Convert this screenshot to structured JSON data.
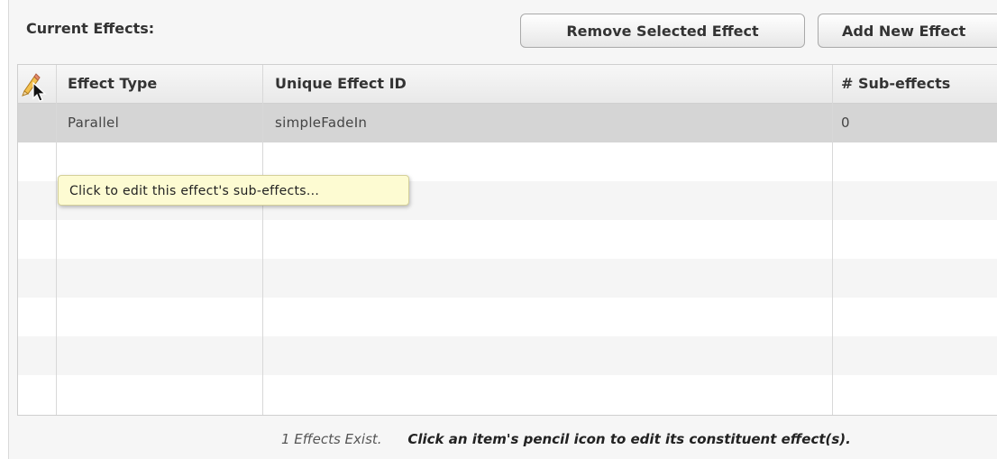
{
  "panel": {
    "title": "Current Effects:",
    "remove_button_label": "Remove Selected Effect",
    "add_button_label": "Add New Effect"
  },
  "table": {
    "columns": [
      "",
      "Effect Type",
      "Unique Effect ID",
      "# Sub-effects"
    ],
    "rows": [
      {
        "effect_type": "Parallel",
        "effect_id": "simpleFadeIn",
        "sub_effects": "0",
        "selected": true
      }
    ]
  },
  "tooltip": {
    "text": "Click to edit this effect's sub-effects..."
  },
  "footer": {
    "count_text": "1 Effects Exist.",
    "hint_text": "Click an item's pencil icon to edit its constituent effect(s)."
  },
  "icons": {
    "edit": "pencil-icon",
    "pointer": "mouse-cursor-icon"
  },
  "colors": {
    "selected_row": "#d5d5d5",
    "tooltip_bg": "#fdfbd2"
  }
}
